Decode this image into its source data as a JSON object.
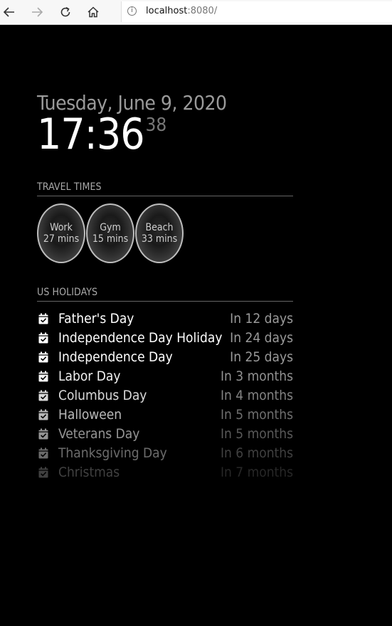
{
  "browser": {
    "url_host": "localhost",
    "url_rest": ":8080/",
    "info_icon": "i"
  },
  "clock": {
    "date": "Tuesday, June 9, 2020",
    "time": "17:36",
    "seconds": "38"
  },
  "travel": {
    "header": "TRAVEL TIMES",
    "destinations": [
      {
        "name": "Work",
        "duration": "27 mins"
      },
      {
        "name": "Gym",
        "duration": "15 mins"
      },
      {
        "name": "Beach",
        "duration": "33 mins"
      }
    ]
  },
  "holidays": {
    "header": "US HOLIDAYS",
    "items": [
      {
        "name": "Father's Day",
        "when": "In 12 days"
      },
      {
        "name": "Independence Day Holiday",
        "when": "In 24 days"
      },
      {
        "name": "Independence Day",
        "when": "In 25 days"
      },
      {
        "name": "Labor Day",
        "when": "In 3 months"
      },
      {
        "name": "Columbus Day",
        "when": "In 4 months"
      },
      {
        "name": "Halloween",
        "when": "In 5 months"
      },
      {
        "name": "Veterans Day",
        "when": "In 5 months"
      },
      {
        "name": "Thanksgiving Day",
        "when": "In 6 months"
      },
      {
        "name": "Christmas",
        "when": "In 7 months"
      }
    ],
    "fade_opacity": [
      1,
      1,
      1,
      0.95,
      0.85,
      0.72,
      0.58,
      0.42,
      0.25
    ]
  },
  "colors": {
    "background": "#000000",
    "primary_text": "#ffffff",
    "secondary_text": "#9a9a9a"
  },
  "icons": {
    "back": "arrow-left-icon",
    "forward": "arrow-right-icon",
    "reload": "reload-icon",
    "home": "home-icon",
    "info": "info-icon",
    "holiday": "calendar-check-icon"
  }
}
